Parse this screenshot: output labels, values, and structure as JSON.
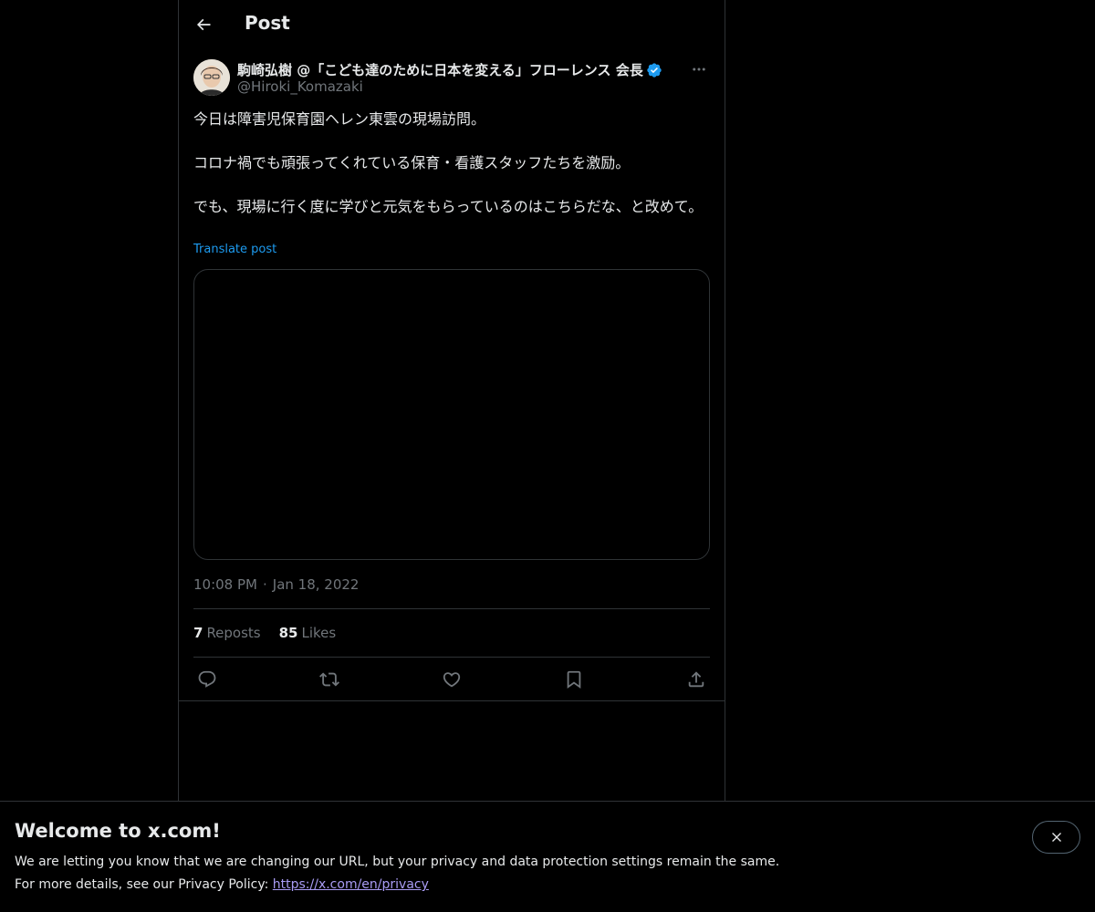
{
  "header": {
    "title": "Post"
  },
  "author": {
    "display_name": "駒崎弘樹 @「こども達のために日本を変える」フローレンス 会長",
    "handle": "@Hiroki_Komazaki",
    "verified": true
  },
  "post": {
    "lines": [
      "今日は障害児保育園ヘレン東雲の現場訪問。",
      "コロナ禍でも頑張ってくれている保育・看護スタッフたちを激励。",
      "でも、現場に行く度に学びと元気をもらっているのはこちらだな、と改めて。"
    ],
    "translate_label": "Translate post",
    "time": "10:08 PM",
    "separator": "·",
    "date": "Jan 18, 2022"
  },
  "stats": {
    "reposts_count": "7",
    "reposts_label": "Reposts",
    "likes_count": "85",
    "likes_label": "Likes"
  },
  "actions": {
    "icons": [
      "reply-icon",
      "repost-icon",
      "like-icon",
      "bookmark-icon",
      "share-icon"
    ]
  },
  "banner": {
    "title": "Welcome to x.com!",
    "line1": "We are letting you know that we are changing our URL, but your privacy and data protection settings remain the same.",
    "line2_prefix": "For more details, see our Privacy Policy: ",
    "link_text": "https://x.com/en/privacy"
  },
  "colors": {
    "background": "#000000",
    "text": "#e7e9ea",
    "muted": "#71767b",
    "accent": "#1d9bf0",
    "border": "#2f3336",
    "link": "#a99cf4"
  }
}
